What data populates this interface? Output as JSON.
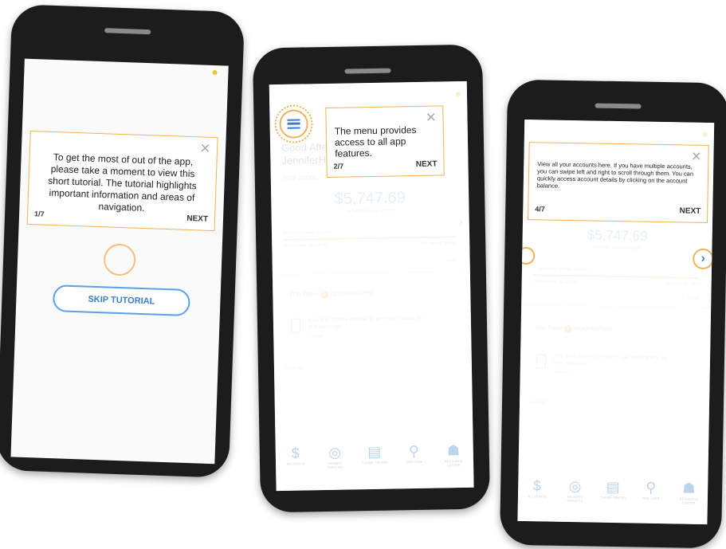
{
  "screen1": {
    "tip_text": "To get the most of out of the app, please take a moment to view this short tutorial. The tutorial highlights important information and areas of navigation.",
    "counter": "1/7",
    "next": "NEXT",
    "close": "✕",
    "skip_button": "SKIP TUTORIAL"
  },
  "screen2": {
    "tip_text": "The menu provides access to all app features.",
    "counter": "2/7",
    "next": "NEXT",
    "close": "✕",
    "greeting_line1": "Good Afte",
    "greeting_line2": "JenniferH",
    "account_heading": "Your accou",
    "balance": "$5,747.69",
    "account_name": "My Health Savings Account",
    "plan_name": "My Health Savings Account",
    "contributions": "Contributions: $6,124.96",
    "irs_limit": "IRS Limit: $7,100.00",
    "details": "Details",
    "opportunities_prefix": "You have",
    "opportunities_count": "1",
    "opportunities_suffix": "opportunities!",
    "opportunity_text": "Add your phone number to get notifications by text message",
    "opportunity_time": "1 minute",
    "view_all": "View All",
    "nav": [
      "ACCOUNTS",
      "PAYMENT SERVICES",
      "CLAIMS CENTER",
      "FIND CARE",
      "RESOURCE CENTER"
    ]
  },
  "screen3": {
    "tip_text": "View all your accounts here. If you have multiple accounts, you can swipe left and right to scroll through them. You can quickly access account details by clicking on the account balance.",
    "counter": "4/7",
    "next": "NEXT",
    "close": "✕",
    "balance": "$5,747.69",
    "account_name": "My Health Savings Account",
    "plan_name": "My Health Savings Account",
    "contributions": "Contributions: $6,124.96",
    "irs_limit": "IRS Limit: $7,100.00",
    "details": "Details",
    "opportunities_prefix": "You have",
    "opportunities_count": "1",
    "opportunities_suffix": "opportunities!",
    "opportunity_text": "Add your phone number to get notifications by text message",
    "opportunity_time": "1 minute",
    "view_all": "View All",
    "nav": [
      "ACCOUNTS",
      "PAYMENT SERVICES",
      "CLAIMS CENTER",
      "FIND CARE",
      "RESOURCE CENTER"
    ]
  },
  "colors": {
    "tooltip_border": "#f0b25a",
    "accent_blue": "#3a7ecb",
    "phone_body": "#1c1c1c"
  }
}
